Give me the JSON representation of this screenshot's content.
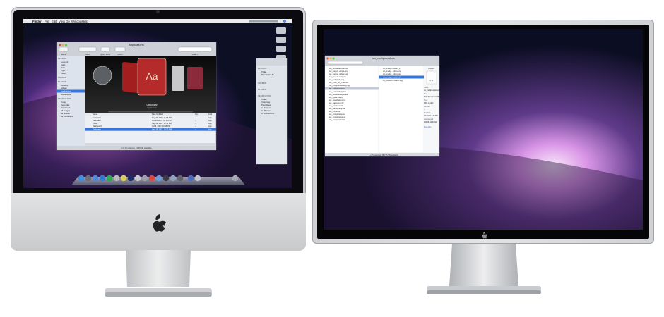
{
  "left_screen": {
    "menubar": {
      "app_name": "Finder",
      "menus": [
        "File",
        "Edit",
        "View",
        "Go",
        "Window",
        "Help"
      ]
    },
    "finder_window": {
      "title": "Applications",
      "toolbar": {
        "labels": [
          "Back",
          "View",
          "Quick Look",
          "Action",
          "Search"
        ]
      },
      "sidebar": {
        "devices_header": "DEVICES",
        "devices": [
          "Leopard",
          "Apps",
          "Data",
          "Tiger",
          "XBak"
        ],
        "shared_header": "SHARED",
        "places_header": "PLACES",
        "places": [
          "Desktop",
          "kglines",
          "Applications",
          "Documents"
        ],
        "search_header": "SEARCH FOR",
        "search": [
          "Today",
          "Yesterday",
          "Past Week",
          "All Images",
          "All Movies",
          "All Documents"
        ]
      },
      "coverflow": {
        "selected_title": "Dictionary",
        "selected_subtitle": "Application",
        "book_glyph": "Aa"
      },
      "list": {
        "columns": [
          "Name",
          "Date Modified",
          "Size",
          "Kind"
        ],
        "rows": [
          {
            "name": "Automator",
            "date": "Sep 23, 2007, 11:16 PM",
            "size": "--",
            "kind": "App"
          },
          {
            "name": "Calculator",
            "date": "Oct 18, 2007, 10:50 PM",
            "size": "--",
            "kind": "App"
          },
          {
            "name": "Chess",
            "date": "Sep 23, 2007, 11:16 PM",
            "size": "--",
            "kind": "App"
          },
          {
            "name": "Dashboard",
            "date": "Oct 9, 2007, 10:55 PM",
            "size": "--",
            "kind": "App"
          },
          {
            "name": "Dictionary",
            "date": "Sep 28, 2007, 10:53 PM",
            "size": "--",
            "kind": "App"
          }
        ]
      },
      "status": "1 of 25 selected, 13.65 GB available"
    },
    "small_finder": {
      "devices_header": "DEVICES",
      "devices": [
        "XBak",
        "Macintosh HD"
      ],
      "shared_header": "SHARED",
      "places_header": "PLACES",
      "search_header": "SEARCH FOR",
      "search": [
        "Today",
        "Yesterday",
        "Past Week",
        "All Images",
        "All Movies",
        "All Documents"
      ]
    }
  },
  "right_screen": {
    "finder_window": {
      "title": "wn_multipmonitors",
      "col1": [
        "wn_sihalbottombar.rtfd",
        "wn_inspec...ample.png",
        "wn_inspec...indow.png",
        "wn_keynotersnippan",
        "wn_multiprefs.png",
        "wn_mom_key_machine",
        "wn_montprintsdialog.png",
        "wn_multipmonitors",
        "wn_newwindowparts",
        "wn_newwindowposition",
        "wn_openfiles.png",
        "wn_opendialog.png",
        "wn_pagesetup.tiff",
        "wn_panelcontrols",
        "wn_panelexamples",
        "wn_printsheet",
        "wn_proxyiconroute",
        "wn_proxyiconmenu",
        "wn_proxyiconsimple"
      ],
      "col2": [
        "wn_multipmonitors_2",
        "wn_multipl...nitors.png",
        "wn_multipl...nitors.psd",
        "wn_multipmonitors.rtf",
        "wn_newwin...osition.png"
      ],
      "preview": {
        "header": "Preview",
        "badge": "RTF",
        "fields": [
          {
            "k": "Name",
            "v": "wn_multipmonitors.rtf"
          },
          {
            "k": "Kind",
            "v": "Rich Text Format (RTF)"
          },
          {
            "k": "Size",
            "v": "4 KB on disk"
          },
          {
            "k": "Created",
            "v": "--"
          },
          {
            "k": "Modified",
            "v": "1/1/16/07 1:28 PM"
          },
          {
            "k": "Last opened",
            "v": "1/11/08 12:03 AM"
          }
        ],
        "more_info": "More info..."
      },
      "status": "1 of 5 selected, 384.35 GB available"
    }
  }
}
